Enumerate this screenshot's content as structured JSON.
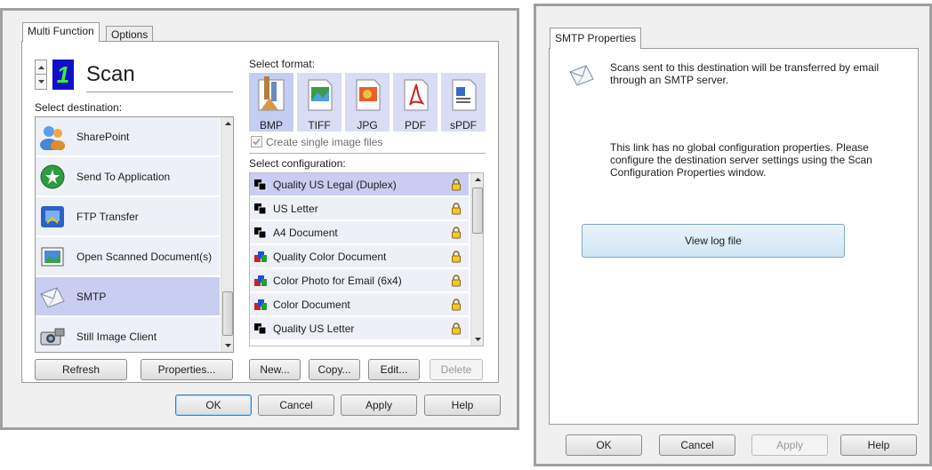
{
  "left_dialog": {
    "tabs": [
      "Multi Function",
      "Options"
    ],
    "scan": {
      "number": "1",
      "title": "Scan"
    },
    "select_destination_label": "Select destination:",
    "destinations": [
      {
        "label": "SharePoint",
        "icon": "sharepoint-icon"
      },
      {
        "label": "Send To Application",
        "icon": "send-to-application-icon"
      },
      {
        "label": "FTP Transfer",
        "icon": "ftp-transfer-icon"
      },
      {
        "label": "Open Scanned Document(s)",
        "icon": "open-scanned-document-icon"
      },
      {
        "label": "SMTP",
        "icon": "smtp-envelope-icon",
        "selected": true
      },
      {
        "label": "Still Image Client",
        "icon": "still-image-client-icon"
      }
    ],
    "select_format_label": "Select format:",
    "formats": [
      {
        "label": "BMP",
        "selected": true
      },
      {
        "label": "TIFF"
      },
      {
        "label": "JPG"
      },
      {
        "label": "PDF"
      },
      {
        "label": "sPDF"
      }
    ],
    "create_single_image_files": "Create single image files",
    "select_configuration_label": "Select configuration:",
    "configurations": [
      {
        "label": "Quality US Legal (Duplex)",
        "color": false,
        "selected": true
      },
      {
        "label": "US Letter",
        "color": false
      },
      {
        "label": "A4 Document",
        "color": false
      },
      {
        "label": "Quality Color Document",
        "color": true
      },
      {
        "label": "Color Photo for Email (6x4)",
        "color": true
      },
      {
        "label": "Color Document",
        "color": true
      },
      {
        "label": "Quality US Letter",
        "color": false
      }
    ],
    "buttons": {
      "refresh": "Refresh",
      "properties": "Properties...",
      "new": "New...",
      "copy": "Copy...",
      "edit": "Edit...",
      "delete": "Delete",
      "ok": "OK",
      "cancel": "Cancel",
      "apply": "Apply",
      "help": "Help"
    }
  },
  "right_dialog": {
    "tab": "SMTP Properties",
    "description": "Scans sent to this destination will be transferred by email through an SMTP server.",
    "info": "This link has no global configuration properties. Please configure the destination server settings using the Scan Configuration Properties window.",
    "view_log_button": "View log file",
    "buttons": {
      "ok": "OK",
      "cancel": "Cancel",
      "apply": "Apply",
      "help": "Help"
    }
  },
  "colors": {
    "selection": "#c9cdf1",
    "list_bg": "#eef0f8",
    "dialog_bg": "#f0f0f0",
    "scan_number_bg": "#1010c8",
    "default_button_border": "#3c7fb1"
  }
}
